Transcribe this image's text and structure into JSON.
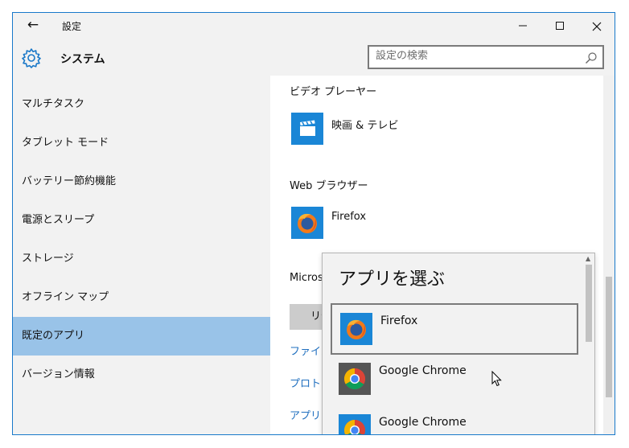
{
  "window": {
    "title": "設定"
  },
  "header": {
    "title": "システム",
    "search_placeholder": "設定の検索"
  },
  "nav": {
    "items": [
      {
        "label": "マルチタスク"
      },
      {
        "label": "タブレット モード"
      },
      {
        "label": "バッテリー節約機能"
      },
      {
        "label": "電源とスリープ"
      },
      {
        "label": "ストレージ"
      },
      {
        "label": "オフライン マップ"
      },
      {
        "label": "既定のアプリ"
      },
      {
        "label": "バージョン情報"
      }
    ],
    "selected": "既定のアプリ"
  },
  "content": {
    "video_player": {
      "label": "ビデオ プレーヤー",
      "app": "映画 & テレビ"
    },
    "web_browser": {
      "label": "Web ブラウザー",
      "app": "Firefox"
    },
    "reset": {
      "label_partial": "Micros",
      "button_partial": "リセ"
    },
    "links": [
      "ファイル",
      "プロトコ",
      "アプリに"
    ]
  },
  "flyout": {
    "title": "アプリを選ぶ",
    "choices": [
      {
        "label": "Firefox",
        "icon": "firefox-icon",
        "selected": true
      },
      {
        "label": "Google Chrome",
        "icon": "chrome-icon",
        "selected": false
      },
      {
        "label": "Google Chrome",
        "icon": "chrome-icon",
        "selected": false
      }
    ]
  },
  "colors": {
    "accent": "#1a86d6",
    "nav_selected": "#99c3e8",
    "chrome_bg": "#f2f2f2",
    "link": "#1f6fbf"
  }
}
